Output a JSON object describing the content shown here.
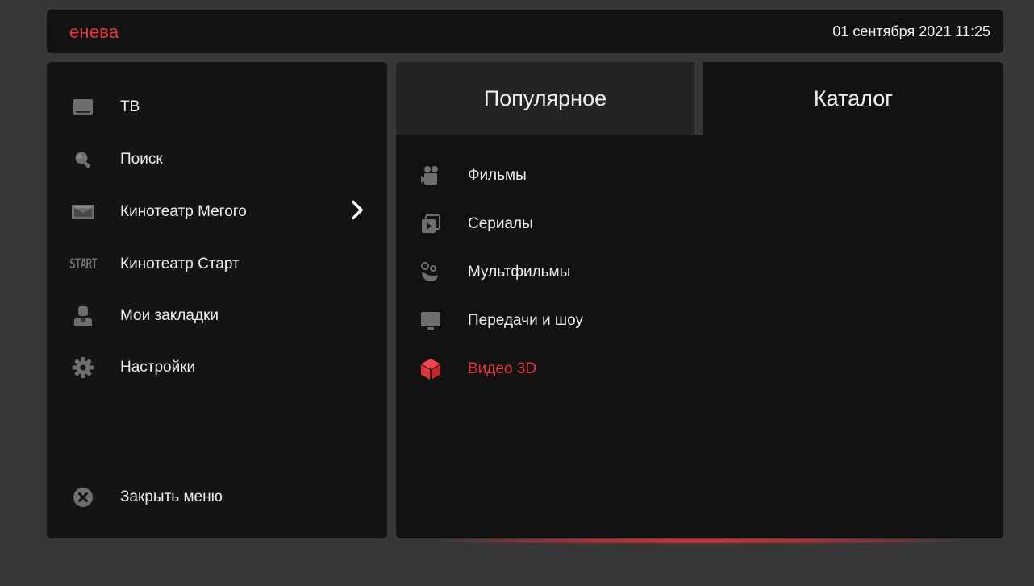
{
  "header": {
    "brand": "енева",
    "datetime": "01 сентября 2021  11:25"
  },
  "sidebar": {
    "items": [
      {
        "label": "ТВ",
        "icon": "tv-icon"
      },
      {
        "label": "Поиск",
        "icon": "search-icon"
      },
      {
        "label": "Кинотеатр Мегого",
        "icon": "cinema-icon"
      },
      {
        "label": "Кинотеатр Старт",
        "icon": "start-logo-icon",
        "icon_text": "START"
      },
      {
        "label": "Мои закладки",
        "icon": "user-bookmarks-icon"
      },
      {
        "label": "Настройки",
        "icon": "gear-icon"
      }
    ],
    "close": {
      "label": "Закрыть меню",
      "icon": "close-icon"
    }
  },
  "tabs": [
    {
      "label": "Популярное"
    },
    {
      "label": "Каталог",
      "active": true
    }
  ],
  "catalog": {
    "items": [
      {
        "label": "Фильмы",
        "icon": "movie-camera-icon"
      },
      {
        "label": "Сериалы",
        "icon": "series-icon"
      },
      {
        "label": "Мультфильмы",
        "icon": "cartoon-icon"
      },
      {
        "label": "Передачи и шоу",
        "icon": "monitor-icon"
      },
      {
        "label": "Видео 3D",
        "icon": "cube-3d-icon",
        "active": true
      }
    ]
  },
  "colors": {
    "accent": "#e8333c",
    "background": "#373737",
    "panel": "#141414",
    "tab_inactive": "#242424",
    "icon_gray": "#6e6e6e"
  }
}
